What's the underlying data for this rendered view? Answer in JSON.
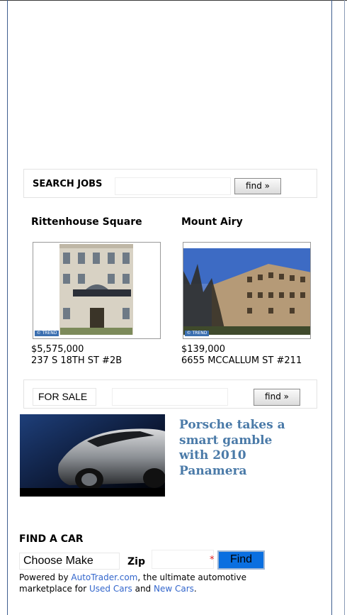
{
  "jobs": {
    "label": "SEARCH JOBS",
    "button_label": "find »"
  },
  "listings": [
    {
      "neighborhood": "Rittenhouse Square",
      "price": "$5,575,000",
      "address": "237 S 18TH ST #2B",
      "badge": "© TREND"
    },
    {
      "neighborhood": "Mount Airy",
      "price": "$139,000",
      "address": "6655 MCCALLUM ST #211",
      "badge": "© TREND"
    }
  ],
  "for_sale": {
    "selected": "FOR SALE",
    "button_label": "find »"
  },
  "story": {
    "headline": "Porsche takes a smart gamble with 2010 Panamera"
  },
  "find_car": {
    "title": "FIND A CAR",
    "make_selected": "Choose Make",
    "zip_label": "Zip",
    "required_mark": "*",
    "button_label": "Find",
    "powered_prefix": "Powered by ",
    "autotrader_link": "AutoTrader.com",
    "powered_middle": ", the ultimate automotive marketplace for ",
    "used_link": "Used Cars",
    "and_text": " and ",
    "new_link": "New Cars",
    "period": "."
  },
  "colors": {
    "headline": "#4a7aa8",
    "link": "#3366cc",
    "find_button": "#0a6fe0",
    "required": "#e02020"
  }
}
